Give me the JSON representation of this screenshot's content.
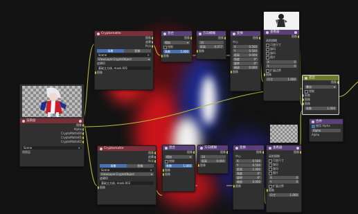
{
  "colors": {
    "bg": "#131313",
    "node_body": "#303030",
    "header_purple": "#5a3f78",
    "header_red": "#7a2e37",
    "header_olive": "#6d7a2a",
    "socket_yellow": "#c7c729",
    "socket_grey": "#a1a1a1",
    "link": "#b8b83a",
    "accent_blue": "#4772b3"
  },
  "icons": {
    "node_header": "node-menu-icon",
    "image": "image-icon"
  },
  "image_node": {
    "header": "渲染层",
    "outputs": [
      "图像",
      "Alpha",
      "CryptoMatte00",
      "CryptoMatte01",
      "CryptoMatte02"
    ],
    "scene_value": "Scene",
    "view_layer_label": "视图层"
  },
  "crypto_top": {
    "header": "Cryptomatte",
    "outputs": [
      "图像",
      "遮罩",
      "Pick"
    ],
    "tabs": [
      "场景",
      "图像"
    ],
    "scene": "Scene",
    "layer": "ViewLayer.CryptoObject",
    "mask_label": "遮罩ID",
    "mask_value": "基础立方体, mask.001",
    "input_label": "图像"
  },
  "crypto_bottom": {
    "header": "Cryptomatte",
    "outputs": [
      "图像",
      "遮罩",
      "Pick"
    ],
    "tabs": [
      "场景",
      "图像"
    ],
    "scene": "Scene",
    "layer": "ViewLayer.CryptoObject",
    "mask_label": "遮罩ID",
    "mask_value": "基础立方体, mask.003",
    "input_label": "图像"
  },
  "mix_top": {
    "header": "混合",
    "output": "图像",
    "mode": "相加",
    "clamp": "钳制",
    "factor_label": "系数",
    "factor_value": "1.000",
    "in1": "图像",
    "in2": "图像"
  },
  "mix_bottom": {
    "header": "混合",
    "output": "图像",
    "mode": "相加",
    "clamp": "钳制",
    "factor_label": "系数",
    "factor_value": "1.000",
    "in1": "图像",
    "in2": "图像"
  },
  "blur_top": {
    "header": "方向模糊",
    "output": "图像",
    "iter_value": "10",
    "wrap": "环绕",
    "dist_label": "距离",
    "dist_value": "0.077",
    "in": "图像"
  },
  "blur_bottom": {
    "header": "方向模糊",
    "output": "图像",
    "iter_value": "10",
    "wrap": "环绕",
    "dist_label": "距离",
    "dist_value": "0.000",
    "in": "图像"
  },
  "transform_top": {
    "header": "变换",
    "output": "图像",
    "center_label": "中心",
    "x_label": "X",
    "x_value": "0.500",
    "y_label": "Y",
    "y_value": "0.500",
    "dist_label": "距离",
    "dist_value": "0.000",
    "angle_label": "角度",
    "angle_value": "0°",
    "spin_label": "旋转",
    "spin_value": "0°",
    "zoom_label": "缩放",
    "zoom_value": "0.000",
    "in": "图像"
  },
  "transform_bottom": {
    "header": "变换",
    "output": "图像",
    "center_label": "中心",
    "x_label": "X",
    "x_value": "0.500",
    "y_label": "Y",
    "y_value": "0.500",
    "dist_label": "距离",
    "dist_value": "1.000",
    "angle_label": "角度",
    "angle_value": "0°",
    "spin_label": "旋转",
    "spin_value": "0°",
    "zoom_label": "缩放",
    "zoom_value": "0.000",
    "in": "图像"
  },
  "viewer_top": {
    "header": "查看器",
    "output": "图像",
    "settings": "高斯模糊",
    "opts": [
      "可变尺寸",
      "伽玛",
      "伽玛",
      "图片"
    ],
    "x_label": "X",
    "x_value": "0",
    "y_label": "Y",
    "y_value": "0",
    "size_label": "扩展边界",
    "in1": "图像",
    "in2": "尺寸",
    "in2_value": "1.000"
  },
  "viewer_bottom": {
    "header": "查看器",
    "output": "图像",
    "settings": "高斯模糊",
    "opts": [
      "可变尺寸",
      "伽玛",
      "伽玛",
      "图片"
    ],
    "x_label": "X",
    "x_value": "0",
    "y_label": "Y",
    "y_value": "0",
    "size_label": "扩展边界",
    "in1": "图像",
    "in2": "尺寸",
    "in2_value": "1.000"
  },
  "mixout_node": {
    "header": "混合",
    "output": "图像",
    "mode": "叠加",
    "clamp": "钳制",
    "in1": "系数",
    "in2": "图像",
    "in3": "图像",
    "extra": "Alpha",
    "f_label": "系数",
    "f_value": "1.000"
  },
  "alpha_node": {
    "header": "合并",
    "label": "使用 Alpha",
    "value": "Alpha"
  }
}
